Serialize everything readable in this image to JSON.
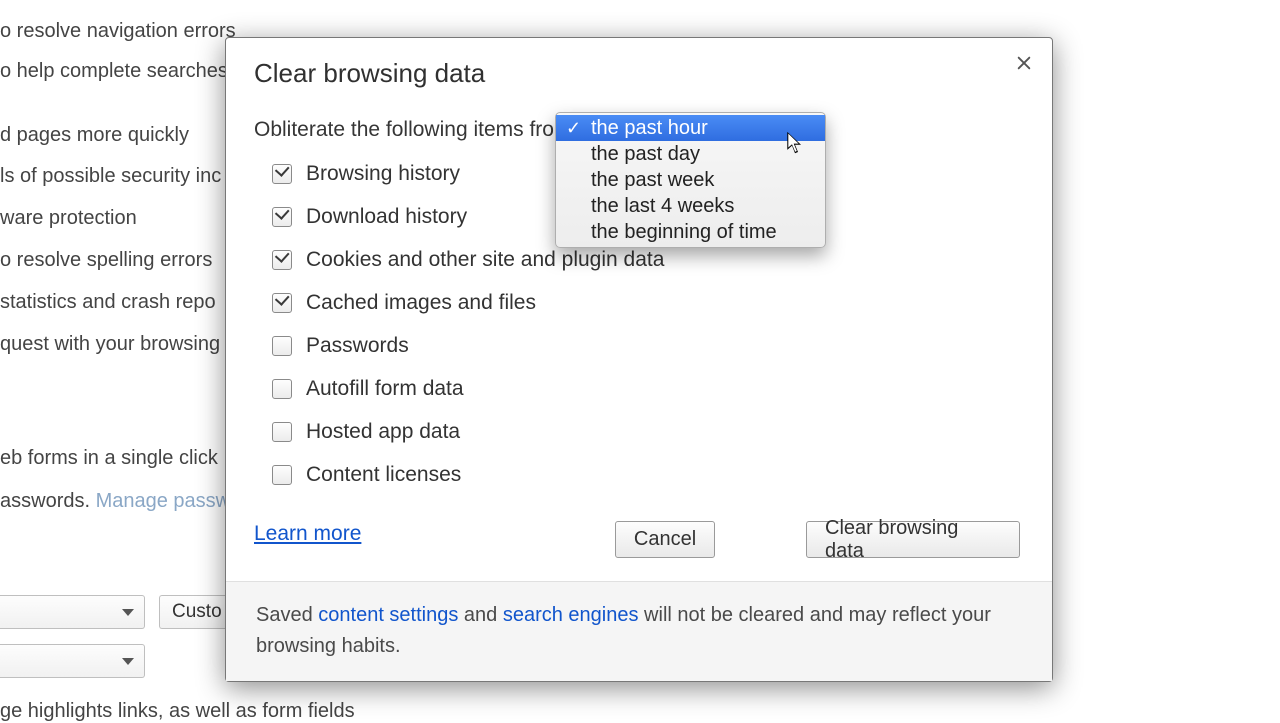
{
  "bg": {
    "l1": "o resolve navigation errors",
    "l2": "o help complete searches",
    "l3": "d pages more quickly",
    "l4": "ls of possible security inc",
    "l5": "ware protection",
    "l6": "o resolve spelling errors",
    "l7": "  statistics and crash repo",
    "l8": "quest with your browsing",
    "l9": "eb forms in a single click",
    "l10a": "asswords.  ",
    "l10b": "Manage passw",
    "l11": "Custo",
    "l12": "ge highlights links, as well as form fields"
  },
  "modal": {
    "title": "Clear browsing data",
    "prompt": "Obliterate the following items from:",
    "options": [
      {
        "label": "Browsing history",
        "checked": true
      },
      {
        "label": "Download history",
        "checked": true
      },
      {
        "label": "Cookies and other site and plugin data",
        "checked": true
      },
      {
        "label": "Cached images and files",
        "checked": true
      },
      {
        "label": "Passwords",
        "checked": false
      },
      {
        "label": "Autofill form data",
        "checked": false
      },
      {
        "label": "Hosted app data",
        "checked": false
      },
      {
        "label": "Content licenses",
        "checked": false
      }
    ],
    "learn_more": "Learn more",
    "cancel": "Cancel",
    "clear": "Clear browsing data",
    "footer_pre": "Saved ",
    "footer_link1": "content settings",
    "footer_mid": " and ",
    "footer_link2": "search engines",
    "footer_post": " will not be cleared and may reflect your browsing habits."
  },
  "dropdown": {
    "items": [
      "the past hour",
      "the past day",
      "the past week",
      "the last 4 weeks",
      "the beginning of time"
    ],
    "selected_index": 0
  }
}
